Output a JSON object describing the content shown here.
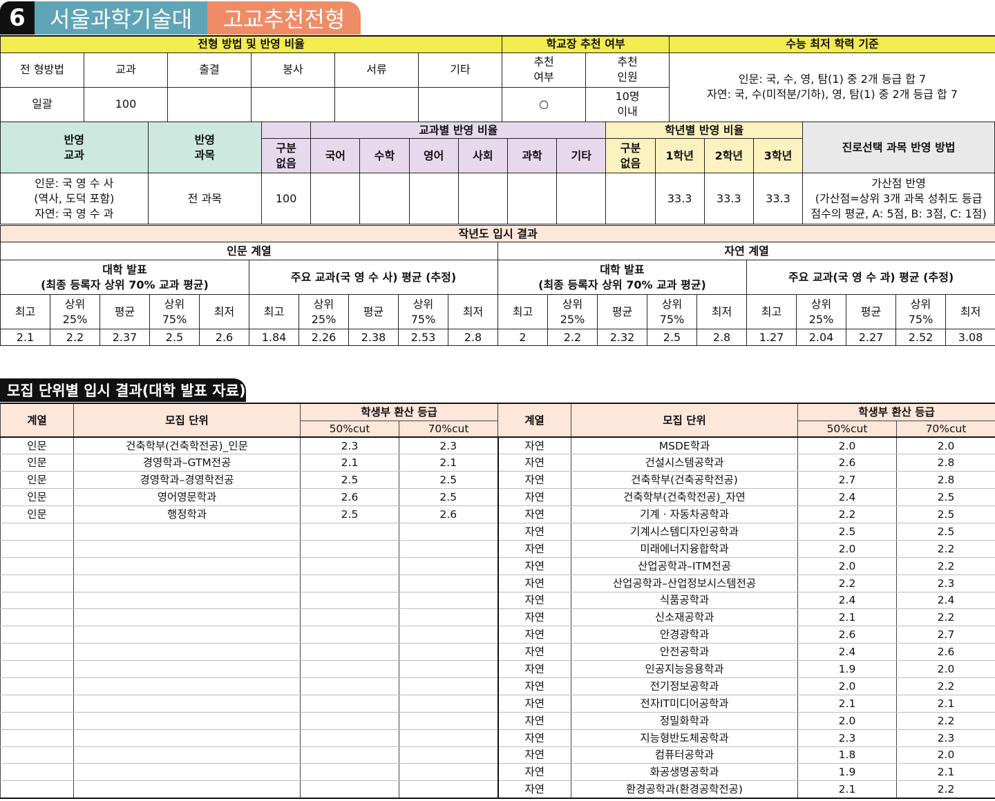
{
  "header": {
    "number": "6",
    "university": "서울과학기술대",
    "type": "고교추천전형"
  },
  "t1": {
    "h_method": "전형 방법 및 반영 비율",
    "h_principal": "학교장 추천 여부",
    "h_csat": "수능 최저 학력 기준",
    "cols": [
      "전 형방법",
      "교과",
      "출결",
      "봉사",
      "서류",
      "기타"
    ],
    "rec_yn": "추천\n여부",
    "rec_count": "추천\n인원",
    "vals": [
      "일괄",
      "100",
      "",
      "",
      "",
      ""
    ],
    "rec_yn_val": "○",
    "rec_count_val": "10명\n이내",
    "csat": "인문: 국, 수, 영, 탐(1) 중 2개 등급 합 7\n자연: 국, 수(미적분/기하), 영, 탐(1) 중 2개 등급 합 7"
  },
  "t2": {
    "h_subj": "반영\n교과",
    "h_course": "반영\n과목",
    "h_subj_ratio": "교과별 반영 비율",
    "h_year_ratio": "학년별 반영 비율",
    "h_career": "진로선택 과목 반영 방법",
    "nodiv": "구분\n없음",
    "subjects": [
      "국어",
      "수학",
      "영어",
      "사회",
      "과학",
      "기타"
    ],
    "years": [
      "1학년",
      "2학년",
      "3학년"
    ],
    "subj_val": "인문: 국 영 수 사\n(역사, 도덕 포함)\n자연: 국 영 수 과",
    "course_val": "전 과목",
    "nodiv_val": "100",
    "subj_vals": [
      "",
      "",
      "",
      "",
      "",
      ""
    ],
    "year_nodiv_val": "",
    "year_vals": [
      "33.3",
      "33.3",
      "33.3"
    ],
    "career_val": "가산점 반영\n(가산점=상위 3개 과목 성취도 등급\n점수의 평균, A: 5점, B: 3점, C: 1점)"
  },
  "t3": {
    "title": "작년도 입시 결과",
    "hum": "인문 계열",
    "nat": "자연 계열",
    "g1": "대학 발표\n(최종 등록자 상위 70% 교과 평균)",
    "g2_hum": "주요 교과(국 영 수 사) 평균 (추정)",
    "g2_nat": "주요 교과(국 영 수 과) 평균 (추정)",
    "stats": [
      "최고",
      "상위\n25%",
      "평균",
      "상위\n75%",
      "최저"
    ],
    "values": [
      "2.1",
      "2.2",
      "2.37",
      "2.5",
      "2.6",
      "1.84",
      "2.26",
      "2.38",
      "2.53",
      "2.8",
      "2",
      "2.2",
      "2.32",
      "2.5",
      "2.8",
      "1.27",
      "2.04",
      "2.27",
      "2.52",
      "3.08"
    ]
  },
  "section_title": "모집 단위별 입시 결과(대학 발표 자료)",
  "t4": {
    "h_track": "계열",
    "h_unit": "모집 단위",
    "h_grade": "학생부 환산 등급",
    "h50": "50%cut",
    "h70": "70%cut",
    "left": [
      [
        "인문",
        "건축학부(건축학전공)_인문",
        "2.3",
        "2.3"
      ],
      [
        "인문",
        "경영학과–GTM전공",
        "2.1",
        "2.1"
      ],
      [
        "인문",
        "경영학과–경영학전공",
        "2.5",
        "2.5"
      ],
      [
        "인문",
        "영어영문학과",
        "2.6",
        "2.5"
      ],
      [
        "인문",
        "행정학과",
        "2.5",
        "2.6"
      ]
    ],
    "right": [
      [
        "자연",
        "MSDE학과",
        "2.0",
        "2.0"
      ],
      [
        "자연",
        "건설시스템공학과",
        "2.6",
        "2.8"
      ],
      [
        "자연",
        "건축학부(건축공학전공)",
        "2.7",
        "2.8"
      ],
      [
        "자연",
        "건축학부(건축학전공)_자연",
        "2.4",
        "2.5"
      ],
      [
        "자연",
        "기계 · 자동차공학과",
        "2.2",
        "2.5"
      ],
      [
        "자연",
        "기계시스템디자인공학과",
        "2.5",
        "2.5"
      ],
      [
        "자연",
        "미래에너지융합학과",
        "2.0",
        "2.2"
      ],
      [
        "자연",
        "산업공학과–ITM전공",
        "2.0",
        "2.2"
      ],
      [
        "자연",
        "산업공학과–산업정보시스템전공",
        "2.2",
        "2.3"
      ],
      [
        "자연",
        "식품공학과",
        "2.4",
        "2.4"
      ],
      [
        "자연",
        "신소재공학과",
        "2.1",
        "2.2"
      ],
      [
        "자연",
        "안경광학과",
        "2.6",
        "2.7"
      ],
      [
        "자연",
        "안전공학과",
        "2.4",
        "2.6"
      ],
      [
        "자연",
        "인공지능응용학과",
        "1.9",
        "2.0"
      ],
      [
        "자연",
        "전기정보공학과",
        "2.0",
        "2.2"
      ],
      [
        "자연",
        "전자IT미디어공학과",
        "2.1",
        "2.1"
      ],
      [
        "자연",
        "정밀화학과",
        "2.0",
        "2.2"
      ],
      [
        "자연",
        "지능형반도체공학과",
        "2.3",
        "2.3"
      ],
      [
        "자연",
        "컴퓨터공학과",
        "1.8",
        "2.0"
      ],
      [
        "자연",
        "화공생명공학과",
        "1.9",
        "2.1"
      ],
      [
        "자연",
        "환경공학과(환경공학전공)",
        "2.1",
        "2.2"
      ]
    ]
  }
}
